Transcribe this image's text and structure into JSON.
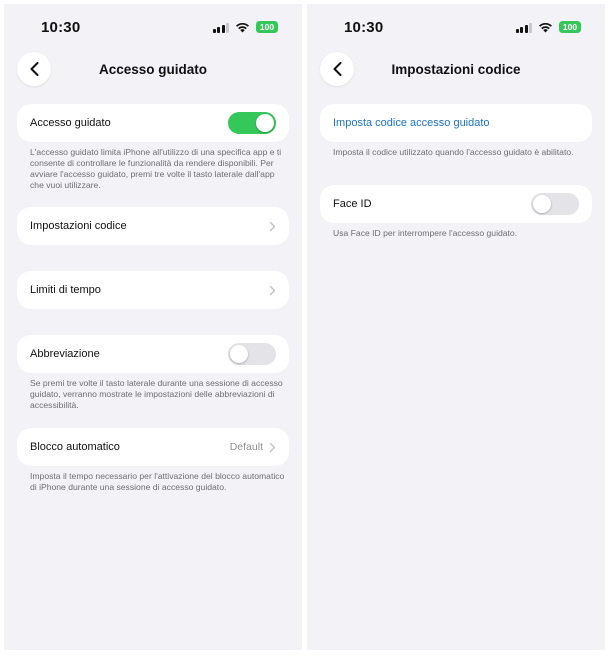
{
  "status_bar": {
    "time": "10:30",
    "battery": "100",
    "battery_color": "#34c759"
  },
  "colors": {
    "toggle_on": "#34c759",
    "toggle_off": "#e3e3e8",
    "link": "#1a73c4",
    "background": "#f2f2f7"
  },
  "left_screen": {
    "title": "Accesso guidato",
    "guided_access": {
      "label": "Accesso guidato",
      "enabled": true,
      "footer": "L'accesso guidato limita iPhone all'utilizzo di una specifica app e ti consente di controllare le funzionalità da rendere disponibili. Per avviare l'accesso guidato, premi tre volte il tasto laterale dall'app che vuoi utilizzare."
    },
    "passcode_settings": {
      "label": "Impostazioni codice"
    },
    "time_limits": {
      "label": "Limiti di tempo"
    },
    "shortcut": {
      "label": "Abbreviazione",
      "enabled": false,
      "footer": "Se premi tre volte il tasto laterale durante una sessione di accesso guidato, verranno mostrate le impostazioni delle abbreviazioni di accessibilità."
    },
    "auto_lock": {
      "label": "Blocco automatico",
      "value": "Default",
      "footer": "Imposta il tempo necessario per l'attivazione del blocco automatico di iPhone durante una sessione di accesso guidato."
    }
  },
  "right_screen": {
    "title": "Impostazioni codice",
    "set_passcode": {
      "label": "Imposta codice accesso guidato",
      "footer": "Imposta il codice utilizzato quando l'accesso guidato è abilitato."
    },
    "face_id": {
      "label": "Face ID",
      "enabled": false,
      "footer": "Usa Face ID per interrompere l'accesso guidato."
    }
  },
  "icons": [
    "back-chevron-icon",
    "chevron-right-icon",
    "cellular-signal-icon",
    "wifi-icon",
    "battery-icon"
  ]
}
